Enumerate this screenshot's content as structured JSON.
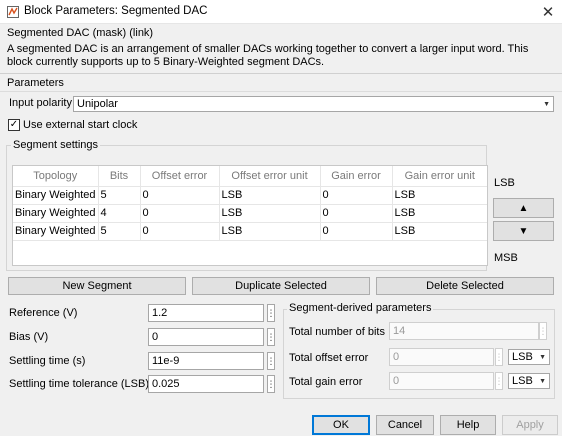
{
  "window": {
    "title": "Block Parameters: Segmented DAC"
  },
  "block": {
    "header": "Segmented DAC (mask) (link)",
    "description": "A segmented DAC is an arrangement of smaller DACs working together to convert a larger input word.  This block currently supports up to 5 Binary-Weighted segment DACs."
  },
  "parameters": {
    "label": "Parameters",
    "input_polarity_label": "Input polarity",
    "input_polarity_value": "Unipolar",
    "external_clock_label": "Use external start clock",
    "external_clock_checked": true
  },
  "segment_settings": {
    "label": "Segment settings",
    "columns": [
      "Topology",
      "Bits",
      "Offset error",
      "Offset error unit",
      "Gain error",
      "Gain error unit"
    ],
    "rows": [
      [
        "Binary Weighted",
        "5",
        "0",
        "LSB",
        "0",
        "LSB"
      ],
      [
        "Binary Weighted",
        "4",
        "0",
        "LSB",
        "0",
        "LSB"
      ],
      [
        "Binary Weighted",
        "5",
        "0",
        "LSB",
        "0",
        "LSB"
      ]
    ],
    "lsb_label": "LSB",
    "msb_label": "MSB",
    "up_symbol": "▲",
    "down_symbol": "▼"
  },
  "segment_buttons": {
    "new": "New Segment",
    "duplicate": "Duplicate Selected",
    "delete": "Delete Selected"
  },
  "fields": {
    "reference_label": "Reference (V)",
    "reference_value": "1.2",
    "bias_label": "Bias (V)",
    "bias_value": "0",
    "settling_label": "Settling time (s)",
    "settling_value": "11e-9",
    "tolerance_label": "Settling time tolerance (LSB)",
    "tolerance_value": "0.025"
  },
  "derived": {
    "label": "Segment-derived parameters",
    "total_bits_label": "Total number of bits",
    "total_bits_value": "14",
    "total_offset_label": "Total offset error",
    "total_offset_value": "0",
    "total_offset_unit": "LSB",
    "total_gain_label": "Total gain error",
    "total_gain_value": "0",
    "total_gain_unit": "LSB"
  },
  "footer": {
    "ok": "OK",
    "cancel": "Cancel",
    "help": "Help",
    "apply": "Apply"
  },
  "icons": {
    "app": "simulink-block-icon",
    "close": "close-icon",
    "more": "ellipsis-icon",
    "dropdown": "chevron-down-icon",
    "check": "checkmark-icon"
  },
  "colors": {
    "focus_border": "#0078d7",
    "window_bg": "#f0f0f0"
  }
}
